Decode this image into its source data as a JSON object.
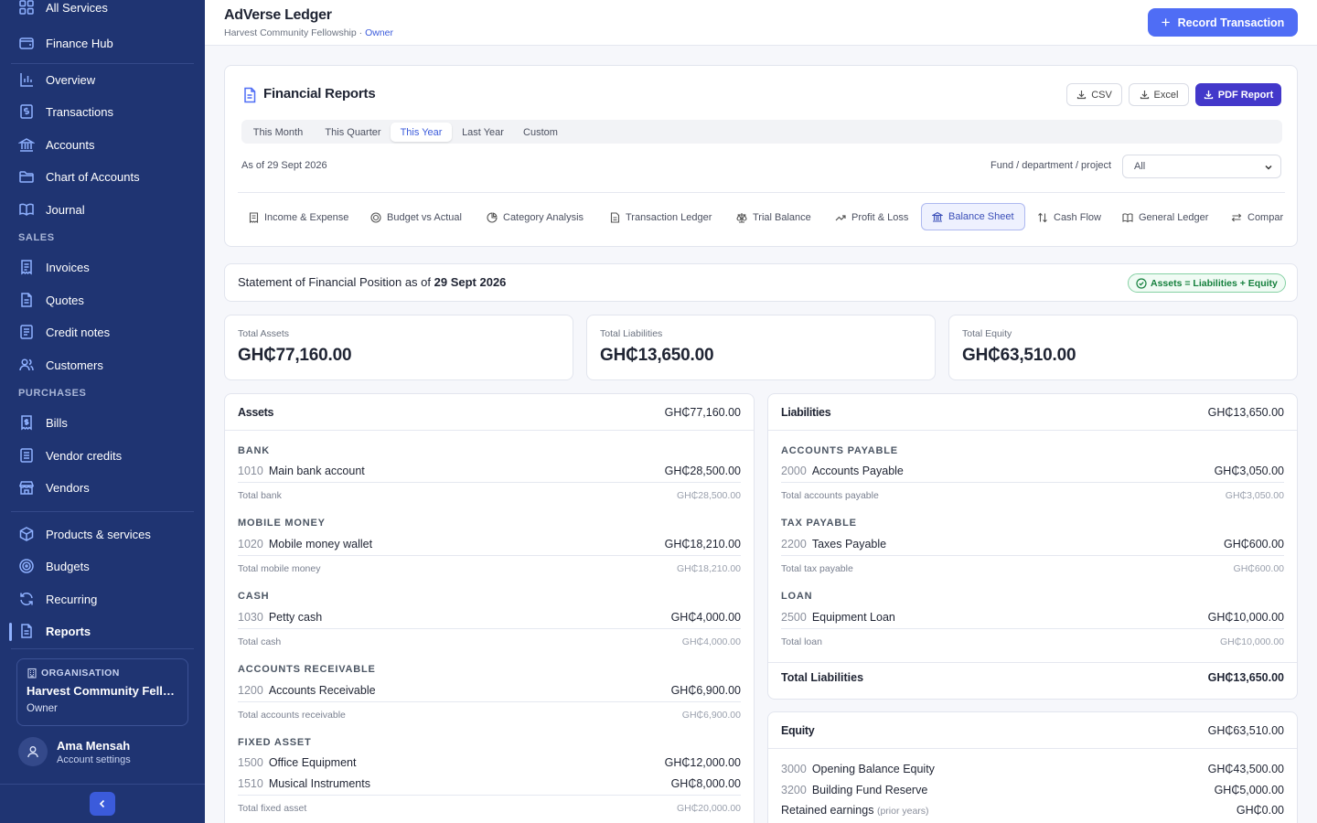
{
  "sidebar": {
    "all_services": "All Services",
    "finance_hub": "Finance Hub",
    "items": [
      {
        "label": "Overview"
      },
      {
        "label": "Transactions"
      },
      {
        "label": "Accounts"
      },
      {
        "label": "Chart of Accounts"
      },
      {
        "label": "Journal"
      }
    ],
    "sales_heading": "SALES",
    "sales": [
      {
        "label": "Invoices"
      },
      {
        "label": "Quotes"
      },
      {
        "label": "Credit notes"
      },
      {
        "label": "Customers"
      }
    ],
    "purchases_heading": "PURCHASES",
    "purchases": [
      {
        "label": "Bills"
      },
      {
        "label": "Vendor credits"
      },
      {
        "label": "Vendors"
      }
    ],
    "more": [
      {
        "label": "Products & services"
      },
      {
        "label": "Budgets"
      },
      {
        "label": "Recurring"
      },
      {
        "label": "Reports"
      }
    ],
    "org": {
      "label": "ORGANISATION",
      "name": "Harvest Community Fello...",
      "role": "Owner"
    },
    "user": {
      "name": "Ama Mensah",
      "link": "Account settings"
    }
  },
  "header": {
    "title": "AdVerse Ledger",
    "org": "Harvest Community Fellowship",
    "separator": " · ",
    "role": "Owner",
    "record_button": "Record Transaction"
  },
  "reports": {
    "title": "Financial Reports",
    "exports": {
      "csv": "CSV",
      "excel": "Excel",
      "pdf": "PDF Report"
    },
    "periods": [
      "This Month",
      "This Quarter",
      "This Year",
      "Last Year",
      "Custom"
    ],
    "active_period": "This Year",
    "as_of": "As of 29 Sept 2026",
    "fund_label": "Fund / department / project",
    "fund_value": "All",
    "report_tabs": [
      "Income & Expense",
      "Budget vs Actual",
      "Category Analysis",
      "Transaction Ledger",
      "Trial Balance",
      "Profit & Loss",
      "Balance Sheet",
      "Cash Flow",
      "General Ledger",
      "Compar"
    ],
    "active_report": "Balance Sheet"
  },
  "statement": {
    "prefix": "Statement of Financial Position as of ",
    "date": "29 Sept 2026",
    "badge": "Assets = Liabilities + Equity"
  },
  "totals": {
    "assets_label": "Total Assets",
    "assets": "GH₵77,160.00",
    "liabilities_label": "Total Liabilities",
    "liabilities": "GH₵13,650.00",
    "equity_label": "Total Equity",
    "equity": "GH₵63,510.00"
  },
  "assets": {
    "title": "Assets",
    "total": "GH₵77,160.00",
    "groups": [
      {
        "name": "BANK",
        "accounts": [
          {
            "code": "1010",
            "name": "Main bank account",
            "amount": "GH₵28,500.00"
          }
        ],
        "subtotal_label": "Total bank",
        "subtotal": "GH₵28,500.00"
      },
      {
        "name": "MOBILE MONEY",
        "accounts": [
          {
            "code": "1020",
            "name": "Mobile money wallet",
            "amount": "GH₵18,210.00"
          }
        ],
        "subtotal_label": "Total mobile money",
        "subtotal": "GH₵18,210.00"
      },
      {
        "name": "CASH",
        "accounts": [
          {
            "code": "1030",
            "name": "Petty cash",
            "amount": "GH₵4,000.00"
          }
        ],
        "subtotal_label": "Total cash",
        "subtotal": "GH₵4,000.00"
      },
      {
        "name": "ACCOUNTS RECEIVABLE",
        "accounts": [
          {
            "code": "1200",
            "name": "Accounts Receivable",
            "amount": "GH₵6,900.00"
          }
        ],
        "subtotal_label": "Total accounts receivable",
        "subtotal": "GH₵6,900.00"
      },
      {
        "name": "FIXED ASSET",
        "accounts": [
          {
            "code": "1500",
            "name": "Office Equipment",
            "amount": "GH₵12,000.00"
          },
          {
            "code": "1510",
            "name": "Musical Instruments",
            "amount": "GH₵8,000.00"
          }
        ],
        "subtotal_label": "Total fixed asset",
        "subtotal": "GH₵20,000.00"
      }
    ]
  },
  "liabilities": {
    "title": "Liabilities",
    "total": "GH₵13,650.00",
    "groups": [
      {
        "name": "ACCOUNTS PAYABLE",
        "accounts": [
          {
            "code": "2000",
            "name": "Accounts Payable",
            "amount": "GH₵3,050.00"
          }
        ],
        "subtotal_label": "Total accounts payable",
        "subtotal": "GH₵3,050.00"
      },
      {
        "name": "TAX PAYABLE",
        "accounts": [
          {
            "code": "2200",
            "name": "Taxes Payable",
            "amount": "GH₵600.00"
          }
        ],
        "subtotal_label": "Total tax payable",
        "subtotal": "GH₵600.00"
      },
      {
        "name": "LOAN",
        "accounts": [
          {
            "code": "2500",
            "name": "Equipment Loan",
            "amount": "GH₵10,000.00"
          }
        ],
        "subtotal_label": "Total loan",
        "subtotal": "GH₵10,000.00"
      }
    ],
    "total_label": "Total Liabilities",
    "total_value": "GH₵13,650.00"
  },
  "equity": {
    "title": "Equity",
    "total": "GH₵63,510.00",
    "accounts": [
      {
        "code": "3000",
        "name": "Opening Balance Equity",
        "amount": "GH₵43,500.00"
      },
      {
        "code": "3200",
        "name": "Building Fund Reserve",
        "amount": "GH₵5,000.00"
      }
    ],
    "retained_label": "Retained earnings",
    "retained_note": "(prior years)",
    "retained_amount": "GH₵0.00"
  },
  "colors": {
    "sidebar": "#1f3472",
    "accent": "#4f6df5",
    "pdf": "#4338ca",
    "success": "#15803d"
  },
  "icons": [
    "grid-icon",
    "wallet-icon",
    "bar-chart-icon",
    "dollar-doc-icon",
    "bank-icon",
    "folder-icon",
    "book-icon",
    "receipt-icon",
    "file-icon",
    "list-icon",
    "users-icon",
    "bill-icon",
    "credit-icon",
    "store-icon",
    "box-icon",
    "target-icon",
    "refresh-icon",
    "report-icon",
    "building-icon",
    "user-icon",
    "chevron-left-icon",
    "plus-icon",
    "download-icon",
    "check-circle-icon",
    "chevron-down-icon"
  ]
}
